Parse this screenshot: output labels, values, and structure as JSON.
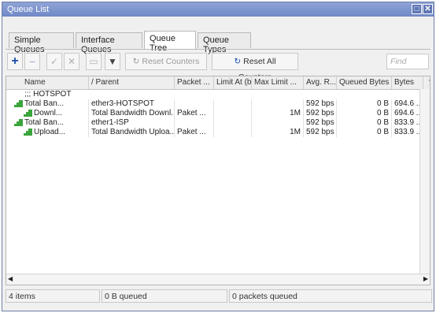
{
  "window": {
    "title": "Queue List"
  },
  "tabs": [
    "Simple Queues",
    "Interface Queues",
    "Queue Tree",
    "Queue Types"
  ],
  "active_tab": "Queue Tree",
  "toolbar": {
    "reset_counters": "Reset Counters",
    "reset_all_counters": "Reset All Counters",
    "find_placeholder": "Find"
  },
  "columns": [
    "Name",
    "Parent",
    "Packet ...",
    "Limit At (b...",
    "Max Limit ...",
    "Avg. R...",
    "Queued Bytes",
    "Bytes"
  ],
  "rows": [
    {
      "type": "group",
      "name": ";;; HOTSPOT"
    },
    {
      "type": "item",
      "indent": 0,
      "name": "Total Ban...",
      "parent": "ether3-HOTSPOT",
      "packet": "",
      "limit_at": "",
      "max_limit": "",
      "avg_rate": "592 bps",
      "queued_bytes": "0 B",
      "bytes": "694.6 ..."
    },
    {
      "type": "item",
      "indent": 1,
      "name": "Downl...",
      "parent": "Total Bandwidth Downl...",
      "packet": "Paket ...",
      "limit_at": "",
      "max_limit": "1M",
      "avg_rate": "592 bps",
      "queued_bytes": "0 B",
      "bytes": "694.6 ..."
    },
    {
      "type": "item",
      "indent": 0,
      "name": "Total Ban...",
      "parent": "ether1-ISP",
      "packet": "",
      "limit_at": "",
      "max_limit": "",
      "avg_rate": "592 bps",
      "queued_bytes": "0 B",
      "bytes": "833.9 ..."
    },
    {
      "type": "item",
      "indent": 1,
      "name": "Upload...",
      "parent": "Total Bandwidth Uploa...",
      "packet": "Paket ...",
      "limit_at": "",
      "max_limit": "1M",
      "avg_rate": "592 bps",
      "queued_bytes": "0 B",
      "bytes": "833.9 ..."
    }
  ],
  "status": {
    "items": "4 items",
    "queued": "0 B queued",
    "packets": "0 packets queued"
  },
  "colors": {
    "titlebar": "#7a90cc",
    "queue_icon": "#3aa53a"
  }
}
